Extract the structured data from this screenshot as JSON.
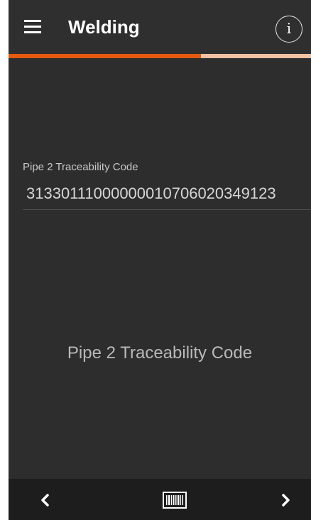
{
  "appbar": {
    "title": "Welding",
    "menu_icon": "hamburger-menu-icon",
    "info_icon": "info-icon",
    "info_glyph": "i"
  },
  "progress": {
    "fraction": 0.635,
    "fill_color": "#e2590f",
    "track_color": "#f2c1a5"
  },
  "form": {
    "field_label": "Pipe 2 Traceability Code",
    "field_value": "31330111000000010706020349123"
  },
  "main": {
    "prompt": "Pipe 2 Traceability Code"
  },
  "bottom_nav": {
    "prev_icon": "chevron-left-icon",
    "scan_icon": "barcode-icon",
    "next_icon": "chevron-right-icon"
  },
  "colors": {
    "background": "#2d2d2d",
    "appbar": "#2f2f2f",
    "bottom_bar": "#1d1d1d",
    "accent": "#e2590f"
  }
}
